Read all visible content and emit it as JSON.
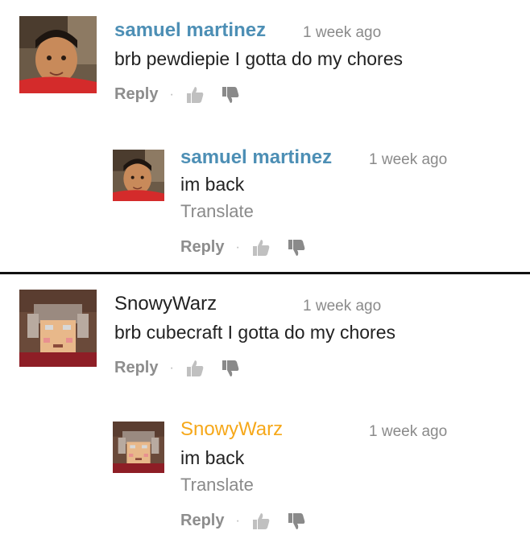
{
  "comments": [
    {
      "author": "samuel martinez",
      "time": "1 week ago",
      "text": "brb pewdiepie I gotta do my chores",
      "reply_label": "Reply",
      "reply": {
        "author": "samuel martinez",
        "time": "1 week ago",
        "text": "im back",
        "translate_label": "Translate",
        "reply_label": "Reply"
      }
    },
    {
      "author": "SnowyWarz",
      "time": "1 week ago",
      "text": "brb cubecraft I gotta do my chores",
      "reply_label": "Reply",
      "reply": {
        "author": "SnowyWarz",
        "time": "1 week ago",
        "text": "im back",
        "translate_label": "Translate",
        "reply_label": "Reply"
      }
    }
  ],
  "icons": {
    "like": "thumbs-up-icon",
    "dislike": "thumbs-down-icon"
  },
  "colors": {
    "author_link": "#4d8fb5",
    "author_highlight": "#f6a81a",
    "meta_gray": "#8a8a8a"
  }
}
